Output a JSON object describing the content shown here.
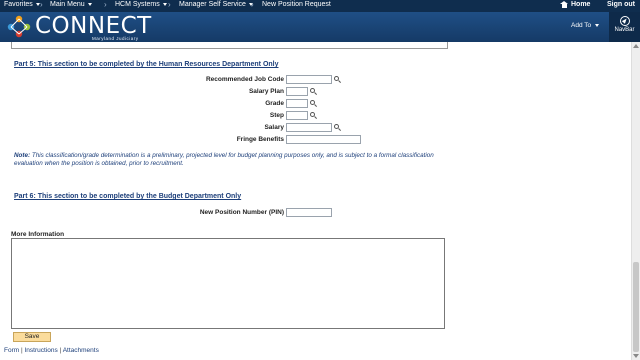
{
  "topnav": {
    "favorites": "Favorites",
    "main_menu": "Main Menu",
    "hcm_systems": "HCM Systems",
    "manager_self_service": "Manager Self Service",
    "page_crumb": "New Position Request",
    "home": "Home",
    "sign_out": "Sign out"
  },
  "banner": {
    "logo_text": "CONNECT",
    "logo_sub": "Maryland Judiciary",
    "add_to": "Add To",
    "navbar": "NavBar"
  },
  "part5": {
    "title": "Part 5: This section to be completed by the Human Resources Department Only",
    "fields": [
      {
        "label": "Recommended Job Code",
        "value": ""
      },
      {
        "label": "Salary Plan",
        "value": ""
      },
      {
        "label": "Grade",
        "value": ""
      },
      {
        "label": "Step",
        "value": ""
      },
      {
        "label": "Salary",
        "value": ""
      },
      {
        "label": "Fringe Benefits",
        "value": ""
      }
    ],
    "note_label": "Note:",
    "note_text": " This classification/grade determination is a preliminary, projected level for budget planning purposes only, and is subject to a formal classification evaluation when the position is obtained, prior to recruitment."
  },
  "part6": {
    "title": "Part 6: This section to be completed by the Budget Department Only",
    "pin_label": "New Position Number (PIN)",
    "pin_value": ""
  },
  "more_info": {
    "label": "More Information",
    "value": ""
  },
  "actions": {
    "save": "Save"
  },
  "footer": {
    "form": "Form",
    "instructions": "Instructions",
    "attachments": "Attachments",
    "separator": "|"
  },
  "colors": {
    "nav_bg": "#0f2d4e",
    "banner_bg": "#1f4f86",
    "link": "#1d3f7a",
    "save_btn": "#fbdc9c"
  }
}
